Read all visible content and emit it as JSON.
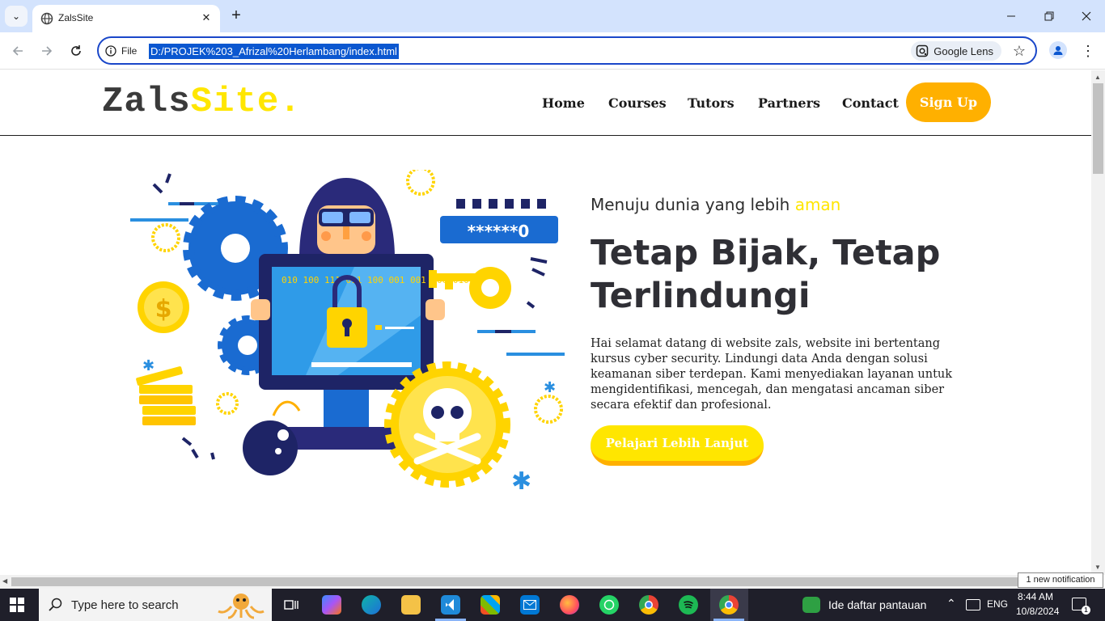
{
  "browser": {
    "tab_title": "ZalsSite",
    "site_info_label": "File",
    "url": "D:/PROJEK%203_Afrizal%20Herlambang/index.html",
    "lens_label": "Google Lens"
  },
  "site": {
    "logo_part1": "Zals",
    "logo_part2": "Site.",
    "nav": [
      "Home",
      "Courses",
      "Tutors",
      "Partners",
      "Contact"
    ],
    "signup_label": "Sign Up",
    "subtitle_prefix": "Menuju dunia yang lebih ",
    "subtitle_highlight": "aman",
    "hero_title": "Tetap Bijak, Tetap Terlindungi",
    "hero_text": "Hai selamat datang di website zals, website ini bertentang kursus cyber security. Lindungi data Anda dengan solusi keamanan siber terdepan. Kami menyediakan layanan untuk mengidentifikasi, mencegah, dan mengatasi ancaman siber secara efektif dan profesional.",
    "cta_label": "Pelajari Lebih Lanjut",
    "password_text": "******0",
    "binary_text": "010 100 111 011 100 001 001 100 010"
  },
  "taskbar": {
    "search_placeholder": "Type here to search",
    "weather_label": "Ide daftar pantauan",
    "language": "ENG",
    "time": "8:44 AM",
    "date": "10/8/2024",
    "notification": "1 new notification"
  },
  "colors": {
    "accent_yellow": "#ffe600",
    "accent_orange": "#ffb000",
    "chrome_blue": "#0b57d0"
  }
}
